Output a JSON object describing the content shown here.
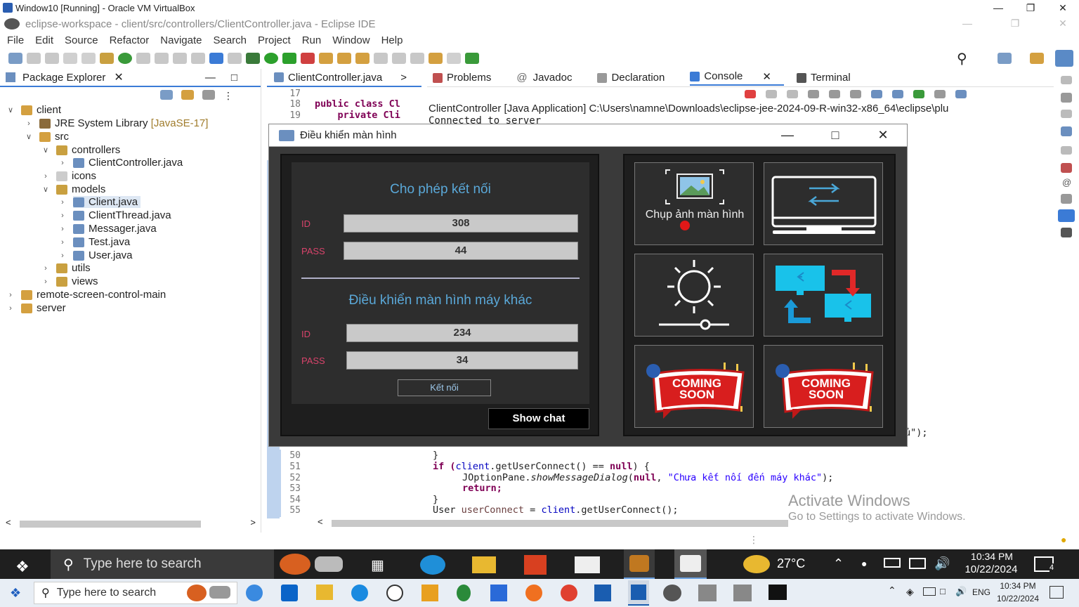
{
  "vbox": {
    "title": "Window10 [Running] - Oracle VM VirtualBox"
  },
  "eclipse": {
    "title": "eclipse-workspace - client/src/controllers/ClientController.java - Eclipse IDE",
    "menu": [
      "File",
      "Edit",
      "Source",
      "Refactor",
      "Navigate",
      "Search",
      "Project",
      "Run",
      "Window",
      "Help"
    ],
    "package_explorer": {
      "title": "Package Explorer",
      "tree": [
        {
          "label": "client"
        },
        {
          "label": "JRE System Library",
          "extra": "[JavaSE-17]"
        },
        {
          "label": "src"
        },
        {
          "label": "controllers"
        },
        {
          "label": "ClientController.java"
        },
        {
          "label": "icons"
        },
        {
          "label": "models"
        },
        {
          "label": "Client.java"
        },
        {
          "label": "ClientThread.java"
        },
        {
          "label": "Messager.java"
        },
        {
          "label": "Test.java"
        },
        {
          "label": "User.java"
        },
        {
          "label": "utils"
        },
        {
          "label": "views"
        },
        {
          "label": "remote-screen-control-main"
        },
        {
          "label": "server"
        }
      ]
    },
    "editor": {
      "tab": "ClientController.java",
      "line_numbers_top": [
        "17",
        "18",
        "19"
      ],
      "code_top": [
        "",
        "public class Cl",
        "    private Cli"
      ],
      "line_numbers_bottom": [
        "50",
        "51",
        "52",
        "53",
        "54",
        "55"
      ],
      "code_bottom_right": "ủ\");",
      "line50": "}",
      "line51_a": "if (",
      "line51_b": "client",
      "line51_c": ".getUserConnect() == ",
      "line51_d": "null",
      "line51_e": ") {",
      "line52_a": "JOptionPane.",
      "line52_b": "showMessageDialog",
      "line52_c": "(",
      "line52_d": "null",
      "line52_e": ", ",
      "line52_f": "\"Chưa kết nối đến máy khác\"",
      "line52_g": ");",
      "line53": "return;",
      "line54": "}",
      "line55_a": "User ",
      "line55_b": "userConnect",
      "line55_c": " = ",
      "line55_d": "client",
      "line55_e": ".getUserConnect();"
    },
    "console": {
      "tabs": [
        "Problems",
        "Javadoc",
        "Declaration",
        "Console",
        "Terminal"
      ],
      "process": "ClientController [Java Application] C:\\Users\\namne\\Downloads\\eclipse-jee-2024-09-R-win32-x86_64\\eclipse\\plu",
      "output": "Connected to server"
    },
    "watermark": {
      "line1": "Activate Windows",
      "line2": "Go to Settings to activate Windows."
    }
  },
  "dialog": {
    "title": "Điều khiển màn hình",
    "allow": {
      "heading": "Cho phép kết nối",
      "id_label": "ID",
      "id_value": "308",
      "pass_label": "PASS",
      "pass_value": "44"
    },
    "control": {
      "heading": "Điều khiển màn hình máy khác",
      "id_label": "ID",
      "id_value": "234",
      "pass_label": "PASS",
      "pass_value": "34",
      "connect_label": "Kết nối"
    },
    "show_chat": "Show chat",
    "tiles": {
      "screenshot": "Chụp ảnh màn hình",
      "coming1": "COMING SOON",
      "coming2": "COMING SOON"
    }
  },
  "taskbar_inner": {
    "search": "Type here to search",
    "temp": "27°C",
    "time": "10:34 PM",
    "date": "10/22/2024",
    "notif": "4"
  },
  "taskbar_outer": {
    "search": "Type here to search",
    "lang": "ENG",
    "time": "10:34 PM",
    "date": "10/22/2024"
  }
}
